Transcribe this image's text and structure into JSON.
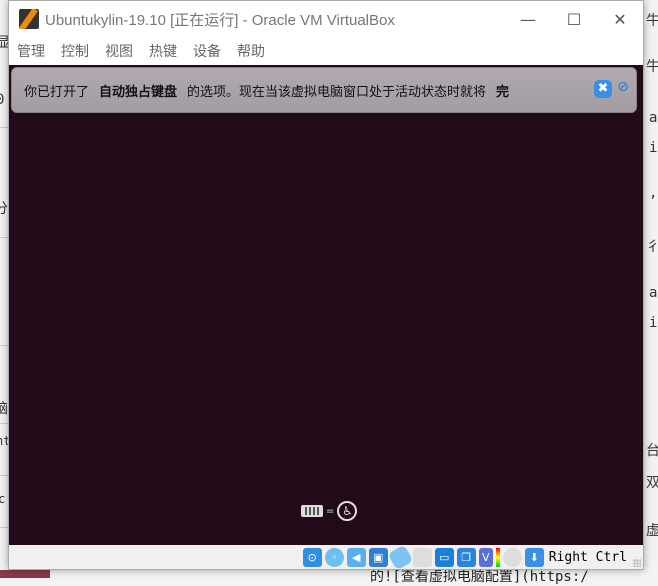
{
  "window": {
    "title": "Ubuntukylin-19.10 [正在运行] - Oracle VM VirtualBox"
  },
  "menu": [
    "管理",
    "控制",
    "视图",
    "热键",
    "设备",
    "帮助"
  ],
  "notice": {
    "before": "你已打开了",
    "bold": "自动独占键盘",
    "after": "的选项。现在当该虚拟电脑窗口处于活动状态时就将",
    "tail": "完"
  },
  "statusbar": {
    "host_key": "Right Ctrl"
  },
  "background": {
    "left": [
      "显",
      "0",
      "分",
      "脑",
      "nt",
      "c"
    ],
    "right": [
      "牛",
      "牛",
      "a",
      "i",
      ",",
      "彳",
      "a",
      "i",
      "台",
      "双",
      "虚"
    ],
    "bottom": "的![查看虚拟电脑配置](https:/"
  }
}
